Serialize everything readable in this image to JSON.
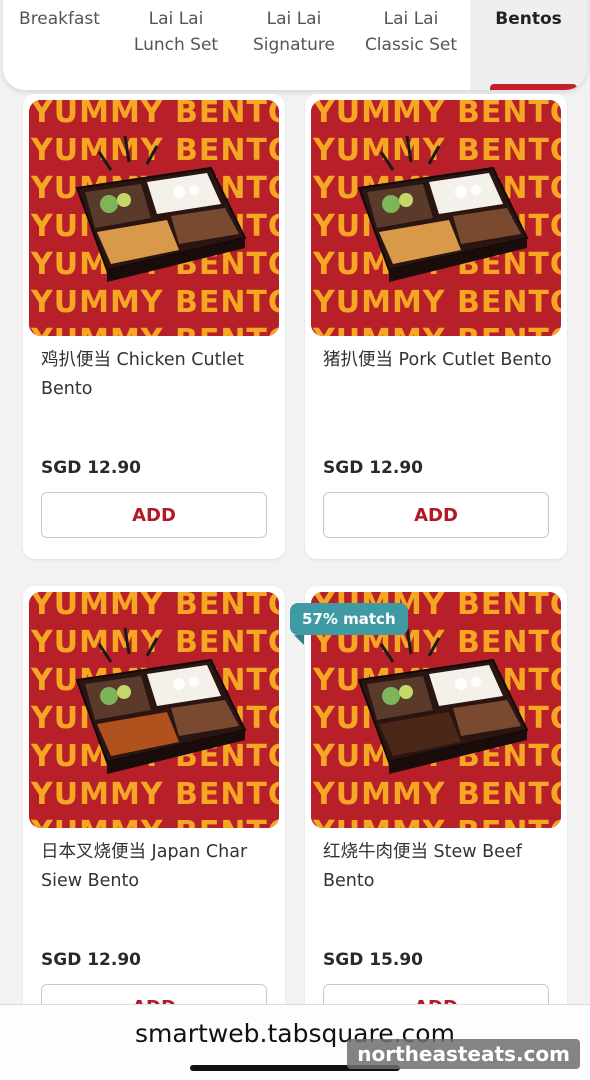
{
  "tabs": [
    {
      "label": "Breakfast",
      "active": false
    },
    {
      "label": "Lai Lai Lunch Set",
      "active": false
    },
    {
      "label": "Lai Lai Signature",
      "active": false
    },
    {
      "label": "Lai Lai Classic Set",
      "active": false
    },
    {
      "label": "Bentos",
      "active": true
    }
  ],
  "colors": {
    "accent": "#c51f2b",
    "banner_bg": "#b82029",
    "banner_text": "#f5a623",
    "badge": "#3f9aa3"
  },
  "banner_text": "YUMMY BENTO",
  "items": [
    {
      "name": "鸡扒便当 Chicken Cutlet Bento",
      "price": "SGD 12.90",
      "add_label": "ADD"
    },
    {
      "name": "猪扒便当 Pork Cutlet Bento",
      "price": "SGD 12.90",
      "add_label": "ADD"
    },
    {
      "name": "日本叉烧便当 Japan Char Siew Bento",
      "price": "SGD 12.90",
      "add_label": "ADD"
    },
    {
      "name": "红烧牛肉便当 Stew Beef Bento",
      "price": "SGD 15.90",
      "add_label": "ADD"
    }
  ],
  "match_badge": "57% match",
  "browser": {
    "url": "smartweb.tabsquare.com"
  },
  "watermark": "northeasteats.com"
}
